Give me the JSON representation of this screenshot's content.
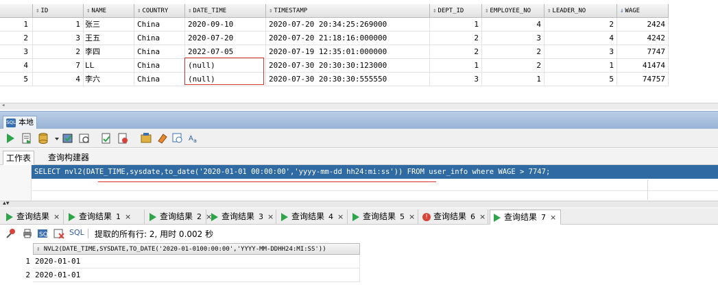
{
  "top_grid": {
    "columns": [
      "ID",
      "NAME",
      "COUNTRY",
      "DATE_TIME",
      "TIMESTAMP",
      "DEPT_ID",
      "EMPLOYEE_NO",
      "LEADER_NO",
      "WAGE"
    ],
    "rows": [
      {
        "rownum": "1",
        "id": "1",
        "name": "张三",
        "country": "China",
        "date_time": "2020-09-10",
        "timestamp": "2020-07-20 20:34:25:269000",
        "dept_id": "1",
        "employee_no": "4",
        "leader_no": "2",
        "wage": "2424"
      },
      {
        "rownum": "2",
        "id": "3",
        "name": "王五",
        "country": "China",
        "date_time": "2020-07-20",
        "timestamp": "2020-07-20 21:18:16:000000",
        "dept_id": "2",
        "employee_no": "3",
        "leader_no": "4",
        "wage": "4242"
      },
      {
        "rownum": "3",
        "id": "2",
        "name": "李四",
        "country": "China",
        "date_time": "2022-07-05",
        "timestamp": "2020-07-19 12:35:01:000000",
        "dept_id": "2",
        "employee_no": "2",
        "leader_no": "3",
        "wage": "7747"
      },
      {
        "rownum": "4",
        "id": "7",
        "name": "LL",
        "country": "China",
        "date_time": "(null)",
        "timestamp": "2020-07-30 20:30:30:123000",
        "dept_id": "1",
        "employee_no": "2",
        "leader_no": "1",
        "wage": "41474"
      },
      {
        "rownum": "5",
        "id": "4",
        "name": "李六",
        "country": "China",
        "date_time": "(null)",
        "timestamp": "2020-07-30 20:30:30:555550",
        "dept_id": "3",
        "employee_no": "1",
        "leader_no": "5",
        "wage": "74757"
      }
    ]
  },
  "connection_tab": {
    "label": "本地",
    "icon_text": "SQL"
  },
  "worksheet_tabs": [
    "工作表",
    "查询构建器"
  ],
  "editor": {
    "sql": "SELECT nvl2(DATE_TIME,sysdate,to_date('2020-01-01 00:00:00','yyyy-mm-dd hh24:mi:ss')) FROM user_info where WAGE > 7747;"
  },
  "result_tabs": [
    {
      "label": "查询结果",
      "num": "",
      "icon": "play"
    },
    {
      "label": "查询结果",
      "num": "1",
      "icon": "play"
    },
    {
      "label": "查询结果",
      "num": "2",
      "icon": "play"
    },
    {
      "label": "查询结果",
      "num": "3",
      "icon": "play"
    },
    {
      "label": "查询结果",
      "num": "4",
      "icon": "play"
    },
    {
      "label": "查询结果",
      "num": "5",
      "icon": "play"
    },
    {
      "label": "查询结果",
      "num": "6",
      "icon": "error"
    },
    {
      "label": "查询结果",
      "num": "7",
      "icon": "play"
    }
  ],
  "result_toolbar": {
    "sql_label": "SQL",
    "status": "提取的所有行: 2, 用时 0.002 秒"
  },
  "result_grid": {
    "column": "NVL2(DATE_TIME,SYSDATE,TO_DATE('2020-01-0100:00:00','YYYY-MM-DDHH24:MI:SS'))",
    "rows": [
      {
        "rownum": "1",
        "value": "2020-01-01"
      },
      {
        "rownum": "2",
        "value": "2020-01-01"
      }
    ]
  },
  "colors": {
    "selection": "#2f6aa3",
    "tab_bar": "#9ab4d6",
    "null_box": "#cc3333",
    "play": "#2ea34a"
  }
}
